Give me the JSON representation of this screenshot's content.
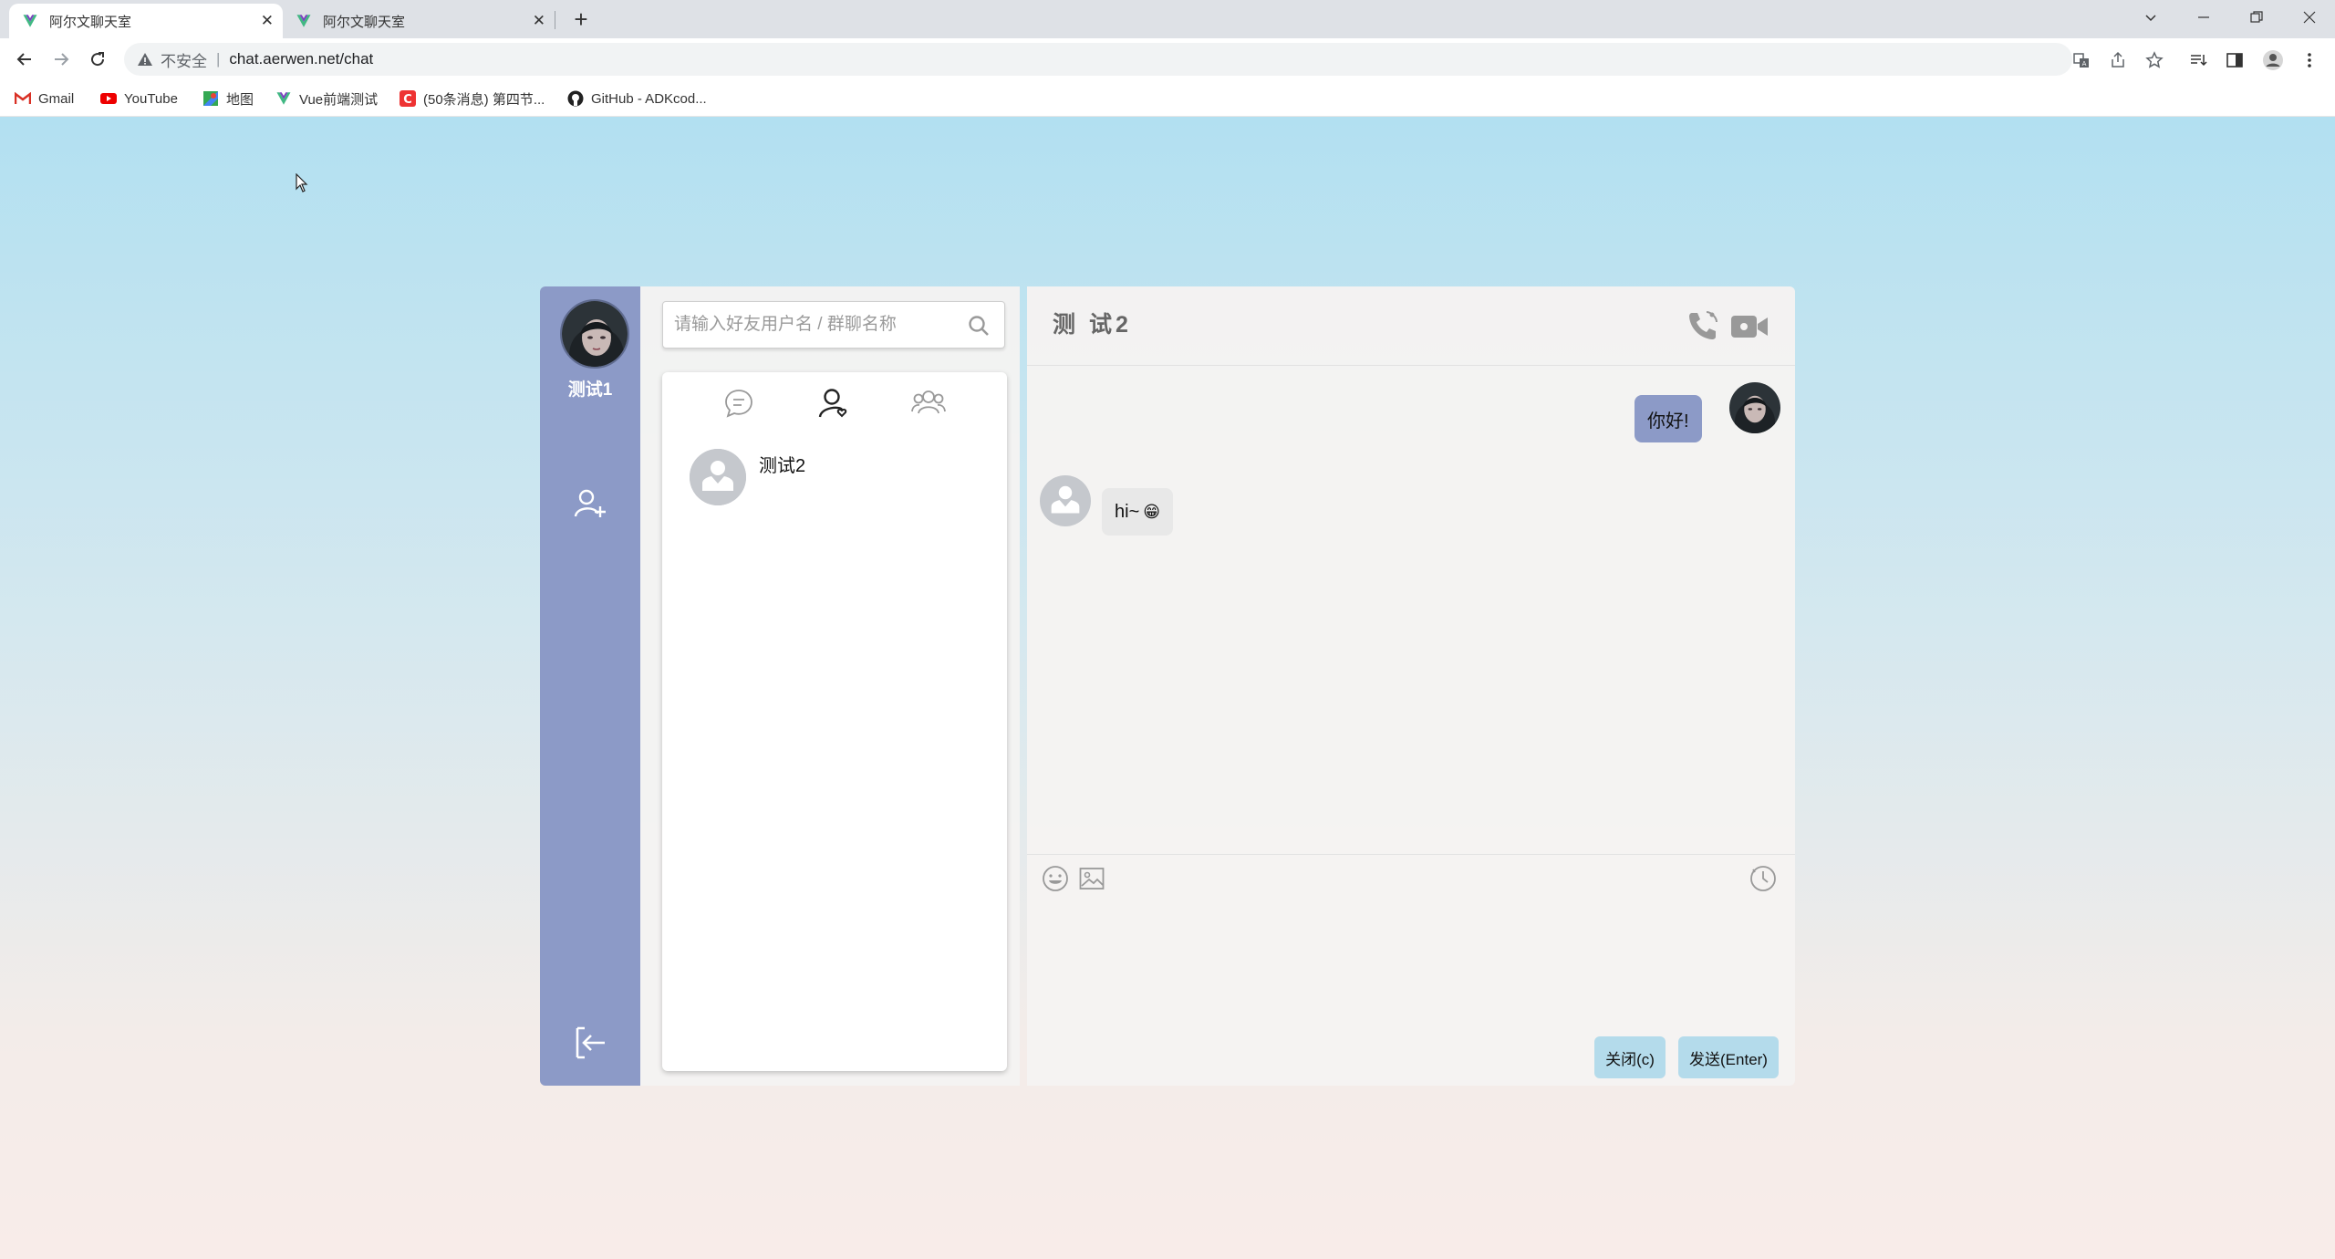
{
  "browser": {
    "tabs": [
      {
        "title": "阿尔文聊天室",
        "active": true
      },
      {
        "title": "阿尔文聊天室",
        "active": false
      }
    ],
    "address": {
      "security_label": "不安全",
      "url": "chat.aerwen.net/chat"
    },
    "bookmarks": [
      {
        "label": "Gmail",
        "icon": "gmail-icon"
      },
      {
        "label": "YouTube",
        "icon": "youtube-icon"
      },
      {
        "label": "地图",
        "icon": "maps-icon"
      },
      {
        "label": "Vue前端测试",
        "icon": "vue-icon"
      },
      {
        "label": "(50条消息) 第四节...",
        "icon": "csdn-icon"
      },
      {
        "label": "GitHub - ADKcod...",
        "icon": "github-icon"
      }
    ]
  },
  "app": {
    "current_user": {
      "name": "测试1"
    },
    "search": {
      "placeholder": "请输入好友用户名 / 群聊名称"
    },
    "contact_tabs": [
      {
        "icon": "chat-bubble-icon",
        "active": false
      },
      {
        "icon": "friend-icon",
        "active": true
      },
      {
        "icon": "group-icon",
        "active": false
      }
    ],
    "contacts": [
      {
        "name": "测试2"
      }
    ],
    "chat": {
      "title": "测 试2",
      "messages": [
        {
          "from": "me",
          "text": "你好!"
        },
        {
          "from": "them",
          "text": "hi~",
          "emoji": "😁"
        }
      ],
      "buttons": {
        "close": "关闭(c)",
        "send": "发送(Enter)"
      }
    },
    "colors": {
      "rail": "#8c9ac7",
      "my_bubble": "#8c9ac7",
      "their_bubble": "#e8e8e8",
      "button": "#b4dbeb"
    }
  }
}
